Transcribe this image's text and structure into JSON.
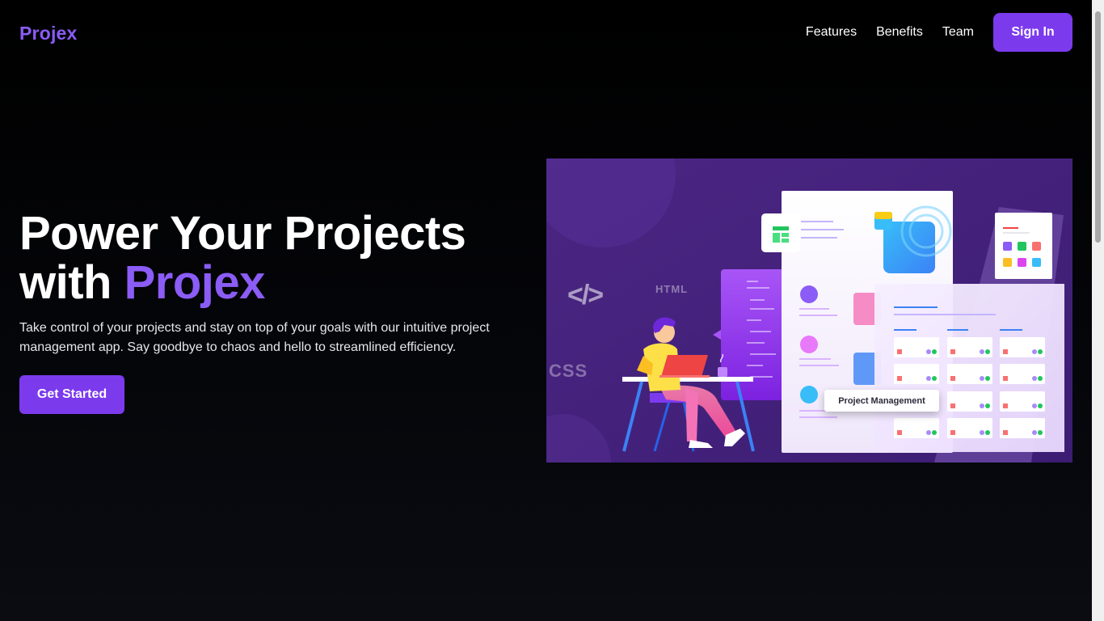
{
  "brand": {
    "logo": "Projex",
    "accent": "#8b5cf6",
    "button_color": "#7c3aed"
  },
  "nav": {
    "links": [
      "Features",
      "Benefits",
      "Team"
    ],
    "signin_label": "Sign In"
  },
  "hero": {
    "title_line1": "Power Your Projects",
    "title_line2_prefix": "with",
    "title_line2_accent": "Projex",
    "description": "Take control of your projects and stay on top of your goals with our intuitive project management app. Say goodbye to chaos and hello to streamlined efficiency.",
    "cta_label": "Get Started"
  },
  "illustration": {
    "code_glyph": "</>",
    "html_glyph": "HTML",
    "css_glyph": "CSS",
    "badge_label": "Project Management"
  }
}
